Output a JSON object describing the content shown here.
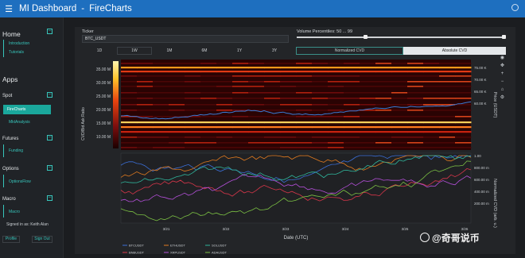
{
  "app": {
    "title": "MI Dashboard",
    "separator": "-",
    "page": "FireCharts"
  },
  "sidebar": {
    "home": "Home",
    "home_items": [
      "Introduction",
      "Tutorials"
    ],
    "apps": "Apps",
    "spot": "Spot",
    "spot_items": [
      "FireCharts",
      "MktAnalysis"
    ],
    "futures": "Futures",
    "futures_items": [
      "Funding"
    ],
    "options": "Options",
    "options_items": [
      "OptionsFlow"
    ],
    "macro": "Macro",
    "macro_items": [
      "Macro"
    ],
    "signed_in": "Signed in as: Keith Alan",
    "profile_btn": "Profile",
    "signout_btn": "Sign Out",
    "toggle_symbol": "–"
  },
  "controls": {
    "ticker_label": "Ticker",
    "ticker_value": "BTC_USDT",
    "volume_label": "Volume Percentiles: 50 ... 99",
    "timeframes": [
      "1D",
      "1W",
      "1M",
      "6M",
      "1Y",
      "3Y"
    ],
    "active_timeframe": "1W",
    "cvd_modes": [
      "Normalized CVD",
      "Absolute CVD"
    ]
  },
  "chart_data": {
    "type": "heatmap",
    "title": "",
    "xlabel": "Date (UTC)",
    "ylabel_left": "CVD/Bid Ask Ratio",
    "ylabel_right_top": "Price (USDT)",
    "ylabel_right_bottom": "Normalized CVD (arb. u.)",
    "y_ticks_left": [
      "35.00 M",
      "30.00 M",
      "25.00 M",
      "20.00 M",
      "15.00 M",
      "10.00 M"
    ],
    "y_ticks_right_top": [
      "75.00 K",
      "70.00 K",
      "65.00 K",
      "60.00 K"
    ],
    "y_ticks_right_bottom": [
      "1.00",
      "800.00 m",
      "600.00 m",
      "400.00 m",
      "200.00 m"
    ],
    "x_ticks": [
      "3/21",
      "3/22",
      "3/23",
      "3/24",
      "3/25",
      "3/26"
    ],
    "legend": [
      "BTCUSDT",
      "ETHUSDT",
      "SOLUSDT",
      "BNBUSDT",
      "XRPUSDT",
      "ADAUSDT"
    ]
  },
  "colors": {
    "accent": "#1aa79c",
    "topbar": "#1e6fbf",
    "price_line": "#3a7bd5"
  },
  "icons": [
    "menu-icon",
    "gear-icon",
    "pan-icon",
    "zoom-in-icon",
    "zoom-out-icon",
    "reset-icon",
    "settings-icon",
    "watermark-logo"
  ],
  "watermark": "@奇哥说币"
}
